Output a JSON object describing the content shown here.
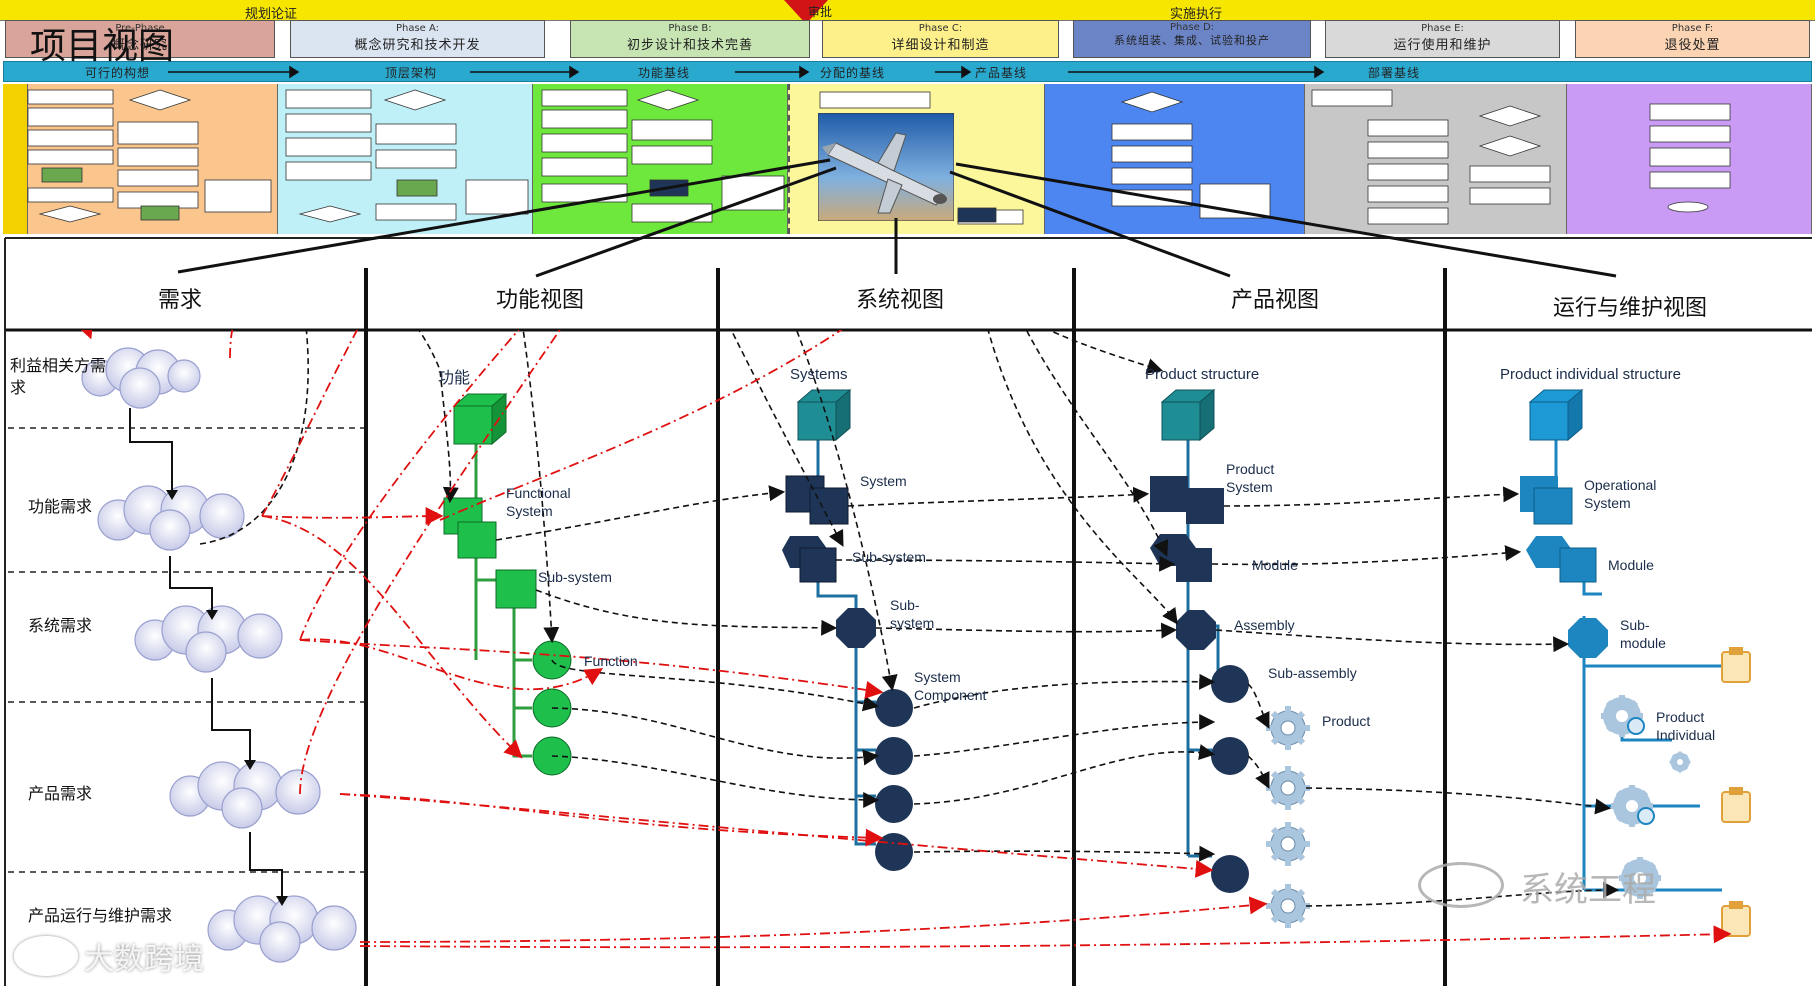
{
  "header": {
    "title": "项目视图",
    "planning_label": "规划论证",
    "execution_label": "实施执行",
    "review_label": "审批",
    "phase_pre_name": "Pre-Phase",
    "phase_pre_desc": "概念研究",
    "phases": [
      {
        "name": "Phase A:",
        "desc": "概念研究和技术开发",
        "color": "#dbe5f1"
      },
      {
        "name": "Phase B:",
        "desc": "初步设计和技术完善",
        "color": "#c6e5b3"
      },
      {
        "name": "Phase C:",
        "desc": "详细设计和制造",
        "color": "#fdf08a"
      },
      {
        "name": "Phase D:",
        "desc": "系统组装、集成、试验和投产",
        "color": "#6b84c6"
      },
      {
        "name": "Phase E:",
        "desc": "运行使用和维护",
        "color": "#d9d9d9"
      },
      {
        "name": "Phase F:",
        "desc": "退役处置",
        "color": "#fbd4b4"
      }
    ],
    "baselines": [
      "可行的构想",
      "顶层架构",
      "功能基线",
      "分配的基线",
      "产品基线",
      "部署基线"
    ]
  },
  "columns": [
    "需求",
    "功能视图",
    "系统视图",
    "产品视图",
    "运行与维护视图"
  ],
  "requirements": [
    "利益相关方需求",
    "功能需求",
    "系统需求",
    "产品需求",
    "产品运行与维护需求"
  ],
  "functional": {
    "title": "功能",
    "system": "Functional System",
    "subsystem": "Sub-system",
    "function": "Function"
  },
  "system_view": {
    "title": "Systems",
    "system": "System",
    "subsystem": "Sub-system",
    "subsystem2": "Sub-system",
    "component": "System Component"
  },
  "product_view": {
    "title": "Product structure",
    "system": "Product System",
    "module": "Module",
    "assembly": "Assembly",
    "subassembly": "Sub-assembly",
    "product": "Product"
  },
  "ops_view": {
    "title": "Product individual  structure",
    "system": "Operational System",
    "module": "Module",
    "submodule": "Sub-module",
    "individual": "Product Individual"
  },
  "watermarks": {
    "right": "系统工程",
    "left": "大数跨境"
  },
  "colors": {
    "header_bg": "#2aa9cf",
    "phase_bar": "#f6e600",
    "green": "#2fc65a",
    "teal": "#1e8e94",
    "navy": "#1f3558",
    "blue": "#1d86c0",
    "red": "#e01010"
  }
}
